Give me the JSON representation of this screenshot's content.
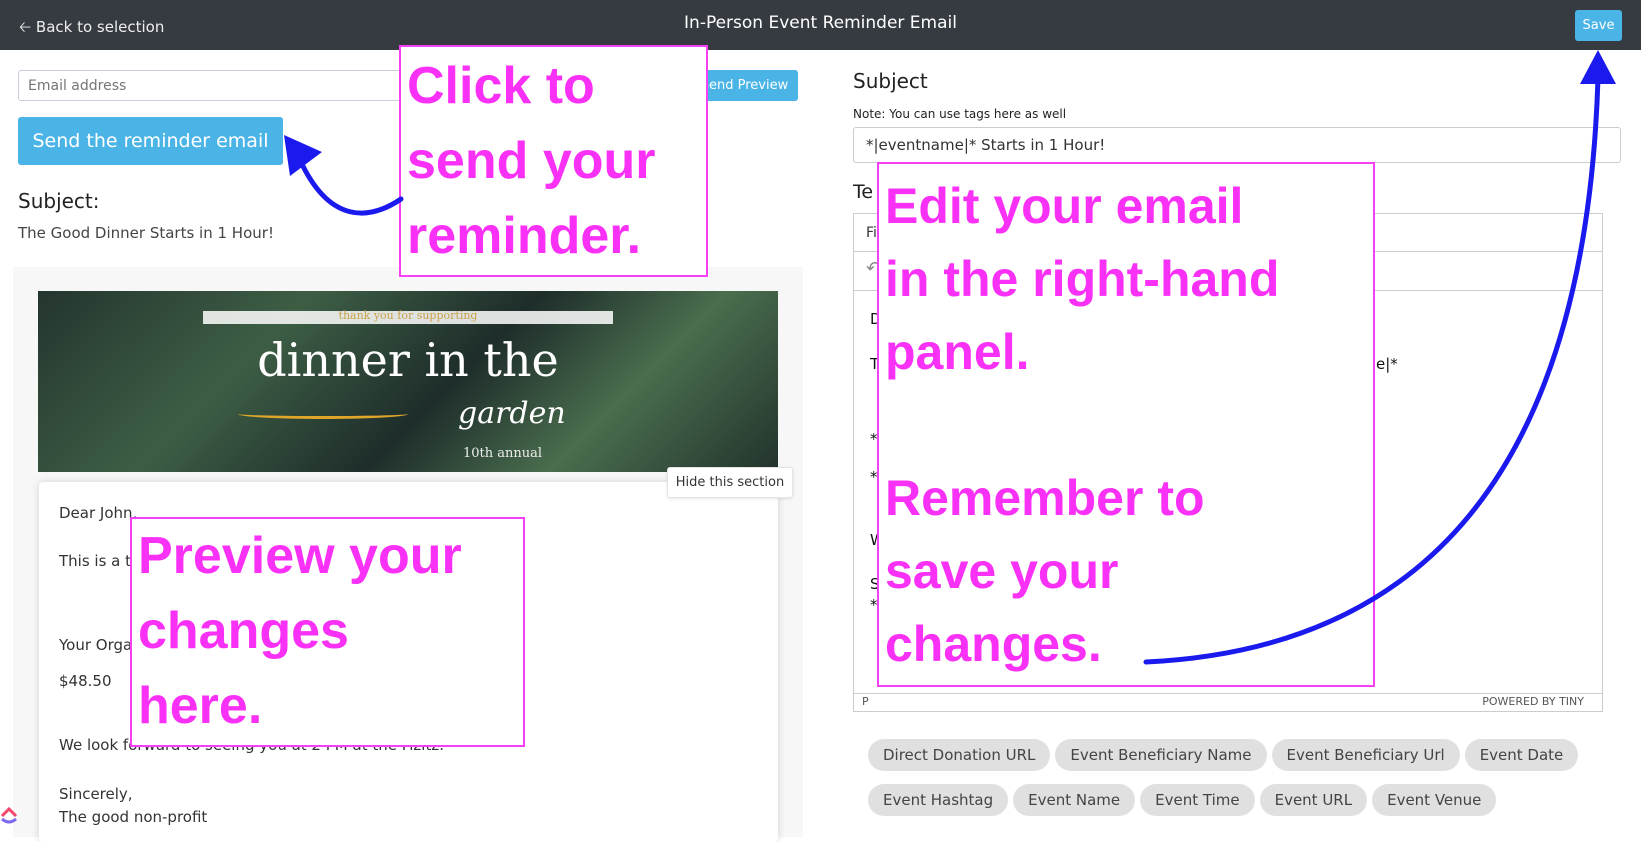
{
  "topbar": {
    "back_label": "Back to selection",
    "title": "In-Person Event Reminder Email",
    "save_label": "Save"
  },
  "left": {
    "email_placeholder": "Email address",
    "send_preview_label": "Send Preview",
    "send_reminder_label": "Send the reminder email",
    "subject_label": "Subject:",
    "subject_text": "The Good Dinner Starts in 1 Hour!",
    "banner": {
      "thank": "thank you for supporting",
      "dinner": "dinner in the",
      "garden": "garden",
      "annual": "10th annual"
    },
    "hide_section_label": "Hide this section",
    "email_lines": [
      "Dear John,",
      "This is a te",
      "Your Orga",
      "$48.50",
      "We look forward to seeing you at 2 PM at the Fizitz.",
      "Sincerely,",
      "The good non-profit"
    ]
  },
  "right": {
    "subject_label": "Subject",
    "note": "Note: You can use tags here as well",
    "subject_value": "*|eventname|* Starts in 1 Hour!",
    "template_label": "Te",
    "editor": {
      "menubar_text": "Fi",
      "lines": [
        "D",
        "T",
        "e|*",
        "*",
        "*",
        "W",
        "S",
        "*"
      ],
      "status_path": "P",
      "powered": "POWERED BY TINY"
    },
    "tags_row1": [
      "Direct Donation URL",
      "Event Beneficiary Name",
      "Event Beneficiary Url",
      "Event Date"
    ],
    "tags_row2": [
      "Event Hashtag",
      "Event Name",
      "Event Time",
      "Event URL",
      "Event Venue"
    ]
  },
  "annotations": {
    "send": "Click to\nsend your\nreminder.",
    "edit": "Edit your email\nin the right-hand\npanel.\n\nRemember to\nsave your\nchanges.",
    "preview": "Preview your\nchanges\nhere."
  },
  "colors": {
    "accent": "#4ab4e6",
    "topbar": "#363a41",
    "annotation": "#f930f5",
    "arrow": "#1a1aee"
  }
}
